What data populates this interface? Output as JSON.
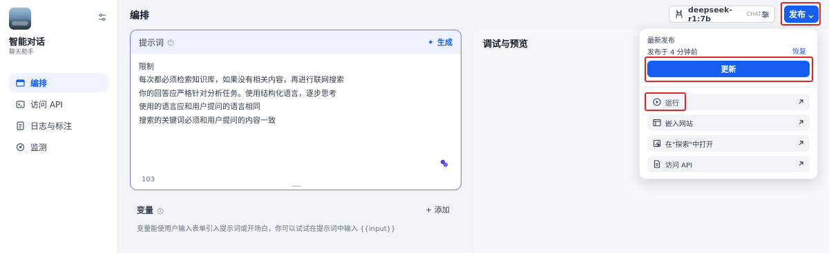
{
  "sidebar": {
    "app_name": "智能对话",
    "app_type": "聊天助手",
    "nav": [
      {
        "label": "编排",
        "icon": "layout-icon",
        "active": true
      },
      {
        "label": "访问 API",
        "icon": "terminal-icon",
        "active": false
      },
      {
        "label": "日志与标注",
        "icon": "file-list-icon",
        "active": false
      },
      {
        "label": "监测",
        "icon": "dashboard-icon",
        "active": false
      }
    ]
  },
  "header": {
    "title": "编排",
    "model_name": "deepseek-r1:7b",
    "model_mode": "CHAT",
    "publish_label": "发布"
  },
  "prompt": {
    "title": "提示词",
    "generate_label": "生成",
    "lines": [
      "限制",
      "每次都必须检索知识库，如果没有相关内容，再进行联网搜索",
      "你的回答应严格针对分析任务。使用结构化语言，逐步思考",
      "使用的语言应和用户提问的语言相同",
      "搜索的关键词必须和用户提问的内容一致"
    ],
    "char_count": "103"
  },
  "variables": {
    "title": "变量",
    "add_label": "+ 添加",
    "description": "变量能使用户输入表单引入提示词或开场白，你可以试试在提示词中输入 {{input}}"
  },
  "debug": {
    "title": "调试与预览"
  },
  "publish_menu": {
    "latest_label": "最新发布",
    "published_time": "发布于 4 分钟前",
    "restore_label": "恢复",
    "update_label": "更新",
    "items": [
      {
        "label": "运行",
        "icon": "play-circle-icon"
      },
      {
        "label": "嵌入网站",
        "icon": "embed-window-icon"
      },
      {
        "label": "在\"探索\"中打开",
        "icon": "explore-icon"
      },
      {
        "label": "访问 API",
        "icon": "api-doc-icon"
      }
    ]
  },
  "colors": {
    "accent": "#155eef",
    "highlight": "#e02424"
  }
}
